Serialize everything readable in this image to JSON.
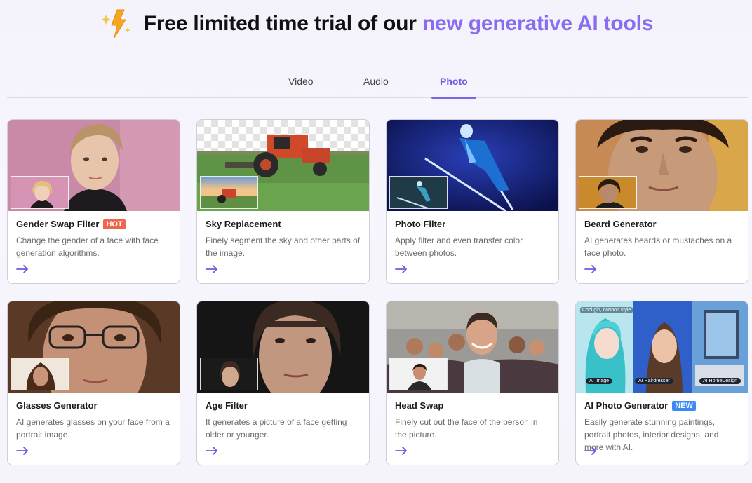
{
  "header": {
    "title_main": "Free limited time trial of our ",
    "title_highlight": "new generative AI tools",
    "icon": "lightning-bolt-icon"
  },
  "tabs": [
    {
      "label": "Video",
      "active": false
    },
    {
      "label": "Audio",
      "active": false
    },
    {
      "label": "Photo",
      "active": true
    }
  ],
  "cards": [
    {
      "title": "Gender Swap Filter",
      "badge": "HOT",
      "desc": "Change the gender of a face with face generation algorithms."
    },
    {
      "title": "Sky Replacement",
      "badge": "",
      "desc": "Finely segment the sky and other parts of the image."
    },
    {
      "title": "Photo Filter",
      "badge": "",
      "desc": "Apply filter and even transfer color between photos."
    },
    {
      "title": "Beard Generator",
      "badge": "",
      "desc": "AI generates beards or mustaches on a face photo."
    },
    {
      "title": "Glasses Generator",
      "badge": "",
      "desc": "AI generates glasses on your face from a portrait image."
    },
    {
      "title": "Age Filter",
      "badge": "",
      "desc": "It generates a picture of a face getting older or younger."
    },
    {
      "title": "Head Swap",
      "badge": "",
      "desc": "Finely cut out the face of the person in the picture."
    },
    {
      "title": "AI Photo Generator",
      "badge": "NEW",
      "desc": "Easily generate stunning paintings, portrait photos, interior designs, and more with AI."
    }
  ],
  "ai_photo_labels": {
    "style": "Cool girl, cartoon style",
    "image": "AI Image",
    "hairdresser": "AI Hairdresser",
    "homedesign": "AI HomeDesign"
  },
  "colors": {
    "accent": "#8b6cf0",
    "tab_active": "#6a5ae0",
    "hot": "#f0664d",
    "new": "#3b8cf2"
  }
}
